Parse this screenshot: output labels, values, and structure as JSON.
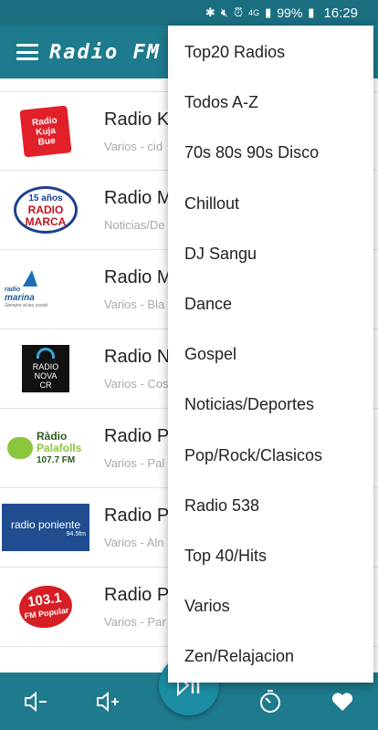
{
  "status_bar": {
    "icons": [
      "bluetooth-icon",
      "mute-icon",
      "alarm-icon",
      "4g-icon",
      "signal-icon",
      "battery-icon"
    ],
    "battery": "99%",
    "time": "16:29"
  },
  "app_bar": {
    "title": "Radio FM"
  },
  "stations": [
    {
      "title": "Radio K",
      "subtitle": "Varios - cid",
      "logo_text": [
        "Radio",
        "Kuja",
        "Bue"
      ]
    },
    {
      "title": "Radio M",
      "subtitle": "Noticias/De",
      "logo_text": [
        "15 años",
        "RADIO",
        "MARCA"
      ]
    },
    {
      "title": "Radio M",
      "subtitle": "Varios - Bla",
      "logo_text": [
        "radio",
        "marina",
        "Siempre al teu costat"
      ]
    },
    {
      "title": "Radio N",
      "subtitle": "Varios - Cos",
      "logo_text": [
        "RADIO",
        "NOVA",
        "CR"
      ]
    },
    {
      "title": "Radio P",
      "subtitle": "Varios - Pal",
      "logo_text": [
        "Ràdio",
        "Palafolls",
        "107.7 FM"
      ]
    },
    {
      "title": "Radio P",
      "subtitle": "Varios - Aln",
      "logo_text": [
        "radio poniente",
        "94.5fm"
      ]
    },
    {
      "title": "Radio P",
      "subtitle": "Varios - Par",
      "logo_text": [
        "103.1",
        "FM Popular"
      ]
    }
  ],
  "menu": {
    "items": [
      "Top20 Radios",
      "Todos A-Z",
      "70s 80s 90s Disco",
      "Chillout",
      "DJ Sangu",
      "Dance",
      "Gospel",
      "Noticias/Deportes",
      "Pop/Rock/Clasicos",
      "Radio 538",
      "Top 40/Hits",
      "Varios",
      "Zen/Relajacion"
    ]
  },
  "bottom_bar": {
    "buttons": [
      "volume-down-icon",
      "volume-up-icon",
      "play-pause-icon",
      "timer-icon",
      "favorite-icon"
    ]
  },
  "colors": {
    "primary": "#1e7a8d",
    "status_bar": "#1a6e80",
    "fab": "#1c8da3"
  }
}
